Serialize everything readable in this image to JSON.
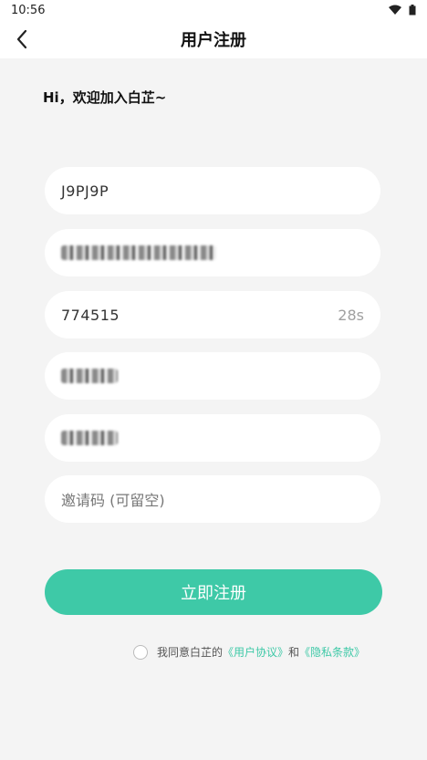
{
  "status_bar": {
    "time": "10:56",
    "icons": [
      "wifi-icon",
      "battery-icon"
    ]
  },
  "nav": {
    "title": "用户注册",
    "back_icon": "chevron-left-icon"
  },
  "greeting": "Hi，欢迎加入白芷~",
  "form": {
    "username_value": "J9PJ9P",
    "phone_value": "",
    "code_value": "774515",
    "code_countdown": "28s",
    "password_value": "",
    "confirm_password_value": "",
    "invite_placeholder": "邀请码 (可留空)"
  },
  "register_button": "立即注册",
  "agreement": {
    "prefix": "我同意白芷的",
    "user_agreement": "《用户协议》",
    "conjunction": "和",
    "privacy_policy": "《隐私条款》"
  },
  "colors": {
    "accent": "#3ec9a7",
    "background": "#f4f4f4"
  }
}
